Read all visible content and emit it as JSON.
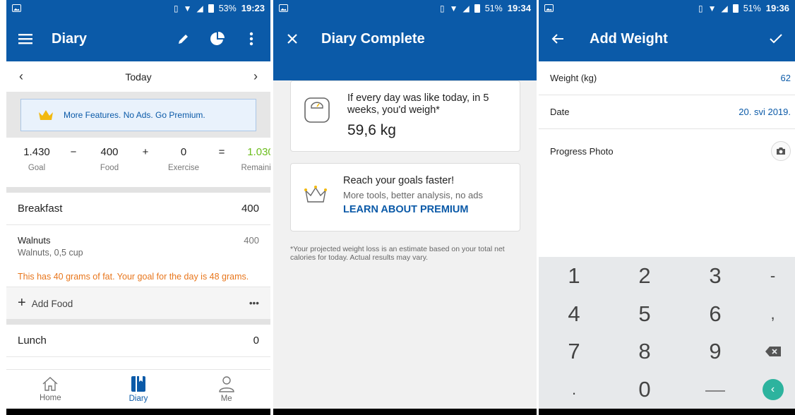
{
  "status_bars": [
    {
      "battery": "53%",
      "time": "19:23"
    },
    {
      "battery": "51%",
      "time": "19:34"
    },
    {
      "battery": "51%",
      "time": "19:36"
    }
  ],
  "diary": {
    "title": "Diary",
    "date": "Today",
    "promo": "More Features. No Ads. Go Premium.",
    "goal_value": "1.430",
    "food_value": "400",
    "exercise_value": "0",
    "remaining_value": "1.030",
    "op_minus": "−",
    "op_plus": "+",
    "op_equals": "=",
    "goal_label": "Goal",
    "food_label": "Food",
    "exercise_label": "Exercise",
    "remaining_label": "Remaining",
    "breakfast": {
      "name": "Breakfast",
      "calories": "400"
    },
    "food_item": {
      "name": "Walnuts",
      "detail": "Walnuts, 0,5 cup",
      "calories": "400"
    },
    "warning": "This has 40 grams of fat. Your goal for the day is 48 grams.",
    "add_food": "Add Food",
    "more": "•••",
    "lunch": {
      "name": "Lunch",
      "calories": "0"
    },
    "tabs": {
      "home": "Home",
      "diary": "Diary",
      "me": "Me"
    },
    "colors": {
      "primary": "#0b5aa8",
      "remaining": "#6bbd1c",
      "warning": "#e8761c"
    }
  },
  "diary_complete": {
    "title": "Diary Complete",
    "projection_text": "If every day was like today, in 5 weeks, you'd weigh*",
    "projection_value": "59,6 kg",
    "premium_title": "Reach your goals faster!",
    "premium_sub": "More tools, better analysis, no ads",
    "premium_link": "LEARN ABOUT PREMIUM",
    "disclaimer": "*Your projected weight loss is an estimate based on your total net calories for today. Actual results may vary."
  },
  "add_weight": {
    "title": "Add Weight",
    "weight_label": "Weight (kg)",
    "weight_value": "62",
    "date_label": "Date",
    "date_value": "20. svi 2019.",
    "photo_label": "Progress Photo",
    "keys": [
      "1",
      "2",
      "3",
      "-",
      "4",
      "5",
      "6",
      ",",
      "7",
      "8",
      "9",
      "⌫",
      ".",
      "0",
      "_",
      "go"
    ]
  }
}
